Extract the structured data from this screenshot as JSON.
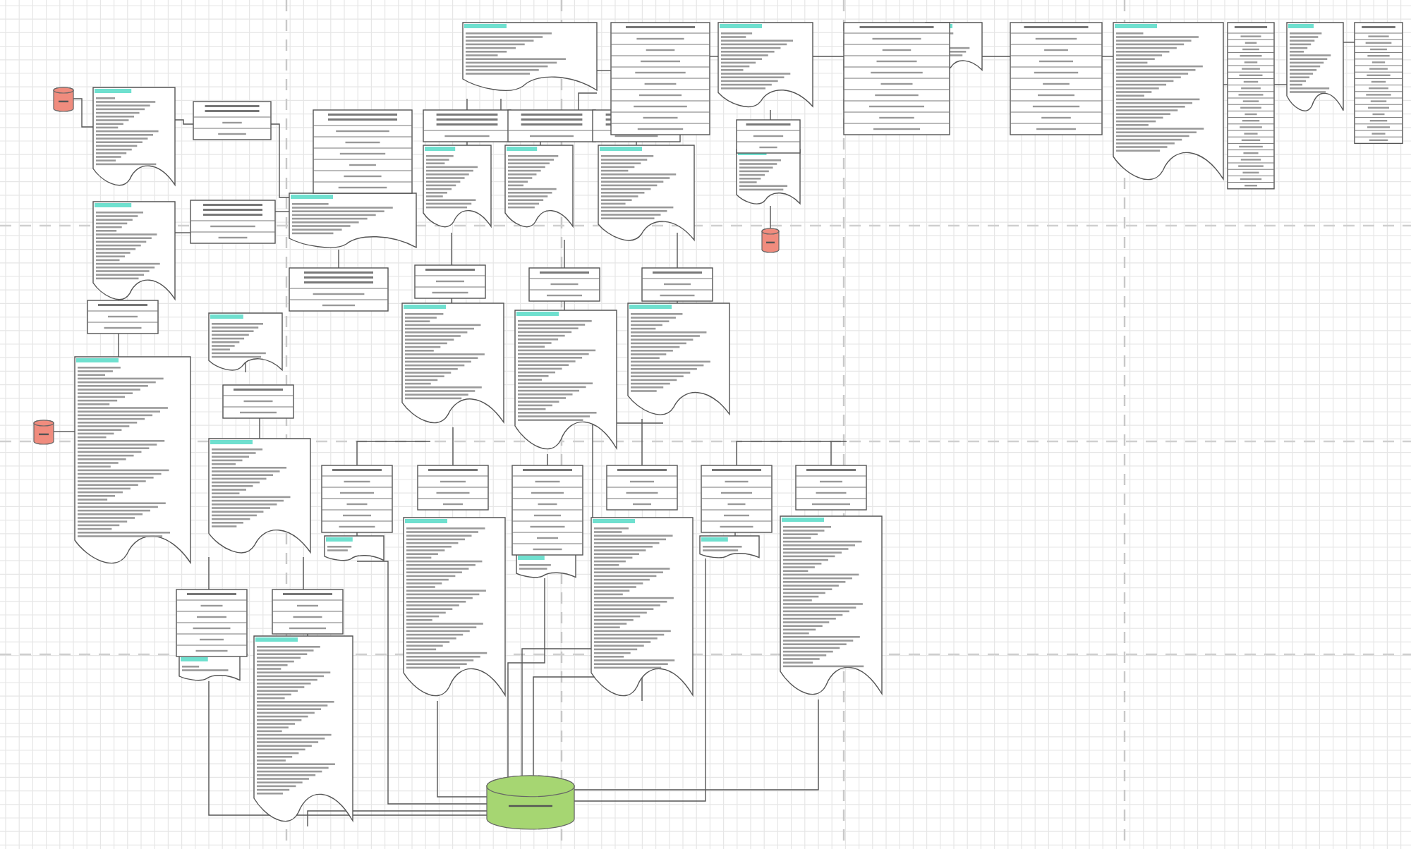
{
  "canvas": {
    "nodes": [
      {
        "kind": "cylinder",
        "color": "#f08c7e"
      },
      {
        "kind": "cylinder",
        "color": "#f08c7e"
      },
      {
        "kind": "cylinder",
        "color": "#f08c7e"
      },
      {
        "kind": "cylinder",
        "color": "#a6d672"
      },
      {
        "kind": "document"
      },
      {
        "kind": "document"
      },
      {
        "kind": "document"
      },
      {
        "kind": "document"
      },
      {
        "kind": "document"
      },
      {
        "kind": "document"
      },
      {
        "kind": "document"
      },
      {
        "kind": "document"
      },
      {
        "kind": "document"
      },
      {
        "kind": "document"
      },
      {
        "kind": "document"
      },
      {
        "kind": "document"
      },
      {
        "kind": "document"
      },
      {
        "kind": "document"
      },
      {
        "kind": "document"
      },
      {
        "kind": "document"
      },
      {
        "kind": "document"
      },
      {
        "kind": "document"
      },
      {
        "kind": "document"
      },
      {
        "kind": "document"
      },
      {
        "kind": "document"
      },
      {
        "kind": "document"
      },
      {
        "kind": "document"
      },
      {
        "kind": "document"
      },
      {
        "kind": "document"
      },
      {
        "kind": "document"
      },
      {
        "kind": "table"
      },
      {
        "kind": "table"
      },
      {
        "kind": "table"
      },
      {
        "kind": "table"
      },
      {
        "kind": "table"
      },
      {
        "kind": "table"
      },
      {
        "kind": "table"
      },
      {
        "kind": "table"
      },
      {
        "kind": "table"
      },
      {
        "kind": "table"
      },
      {
        "kind": "table"
      },
      {
        "kind": "table"
      },
      {
        "kind": "table"
      },
      {
        "kind": "table"
      },
      {
        "kind": "table"
      },
      {
        "kind": "table"
      },
      {
        "kind": "table"
      },
      {
        "kind": "table"
      },
      {
        "kind": "table"
      },
      {
        "kind": "table"
      },
      {
        "kind": "table"
      },
      {
        "kind": "table"
      },
      {
        "kind": "table"
      },
      {
        "kind": "table"
      },
      {
        "kind": "table"
      },
      {
        "kind": "table"
      }
    ]
  }
}
